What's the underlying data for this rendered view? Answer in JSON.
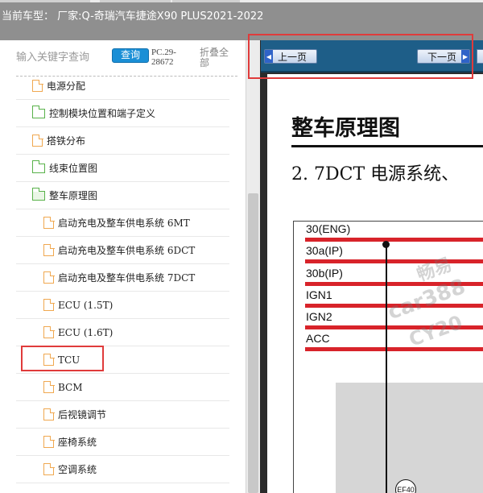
{
  "header": {
    "vehicle_title": "当前车型： 厂家:Q-奇瑞汽车捷途X90 PLUS2021-2022"
  },
  "search": {
    "placeholder": "输入关键字查询",
    "button_label": "查询",
    "doc_code": "PC.29-28672",
    "collapse_label": "折叠全部"
  },
  "tree": {
    "items": [
      {
        "label": "电源分配",
        "icon": "doc-icon",
        "level": 1
      },
      {
        "label": "控制模块位置和端子定义",
        "icon": "folder-icon",
        "level": 1
      },
      {
        "label": "搭铁分布",
        "icon": "doc-icon",
        "level": 1
      },
      {
        "label": "线束位置图",
        "icon": "folder-icon",
        "level": 1
      },
      {
        "label": "整车原理图",
        "icon": "folder-open-icon",
        "level": 1
      },
      {
        "label": "启动充电及整车供电系统 6MT",
        "icon": "doc-icon",
        "level": 2
      },
      {
        "label": "启动充电及整车供电系统 6DCT",
        "icon": "doc-icon",
        "level": 2
      },
      {
        "label": "启动充电及整车供电系统 7DCT",
        "icon": "doc-icon",
        "level": 2
      },
      {
        "label": "ECU (1.5T)",
        "icon": "doc-icon",
        "level": 2
      },
      {
        "label": "ECU (1.6T)",
        "icon": "doc-icon",
        "level": 2
      },
      {
        "label": "TCU",
        "icon": "doc-icon",
        "level": 2
      },
      {
        "label": "BCM",
        "icon": "doc-icon",
        "level": 2
      },
      {
        "label": "后视镜调节",
        "icon": "doc-icon",
        "level": 2
      },
      {
        "label": "座椅系统",
        "icon": "doc-icon",
        "level": 2
      },
      {
        "label": "空调系统",
        "icon": "doc-icon",
        "level": 2
      }
    ]
  },
  "viewer": {
    "prev_label": "上一页",
    "next_label": "下一页",
    "doc_title": "整车原理图",
    "doc_subtitle": "2. 7DCT 电源系统、",
    "rails": [
      "30(ENG)",
      "30a(IP)",
      "30b(IP)",
      "IGN1",
      "IGN2",
      "ACC"
    ],
    "fuse_label": "EF40",
    "watermark": [
      "畅易",
      "car388",
      "CY20"
    ]
  },
  "colors": {
    "header_bg": "#8f8f8f",
    "accent_blue": "#1a8fd6",
    "nav_bar": "#1e5e88",
    "highlight_red": "#e03b3b",
    "rail_red": "#d8232a"
  }
}
